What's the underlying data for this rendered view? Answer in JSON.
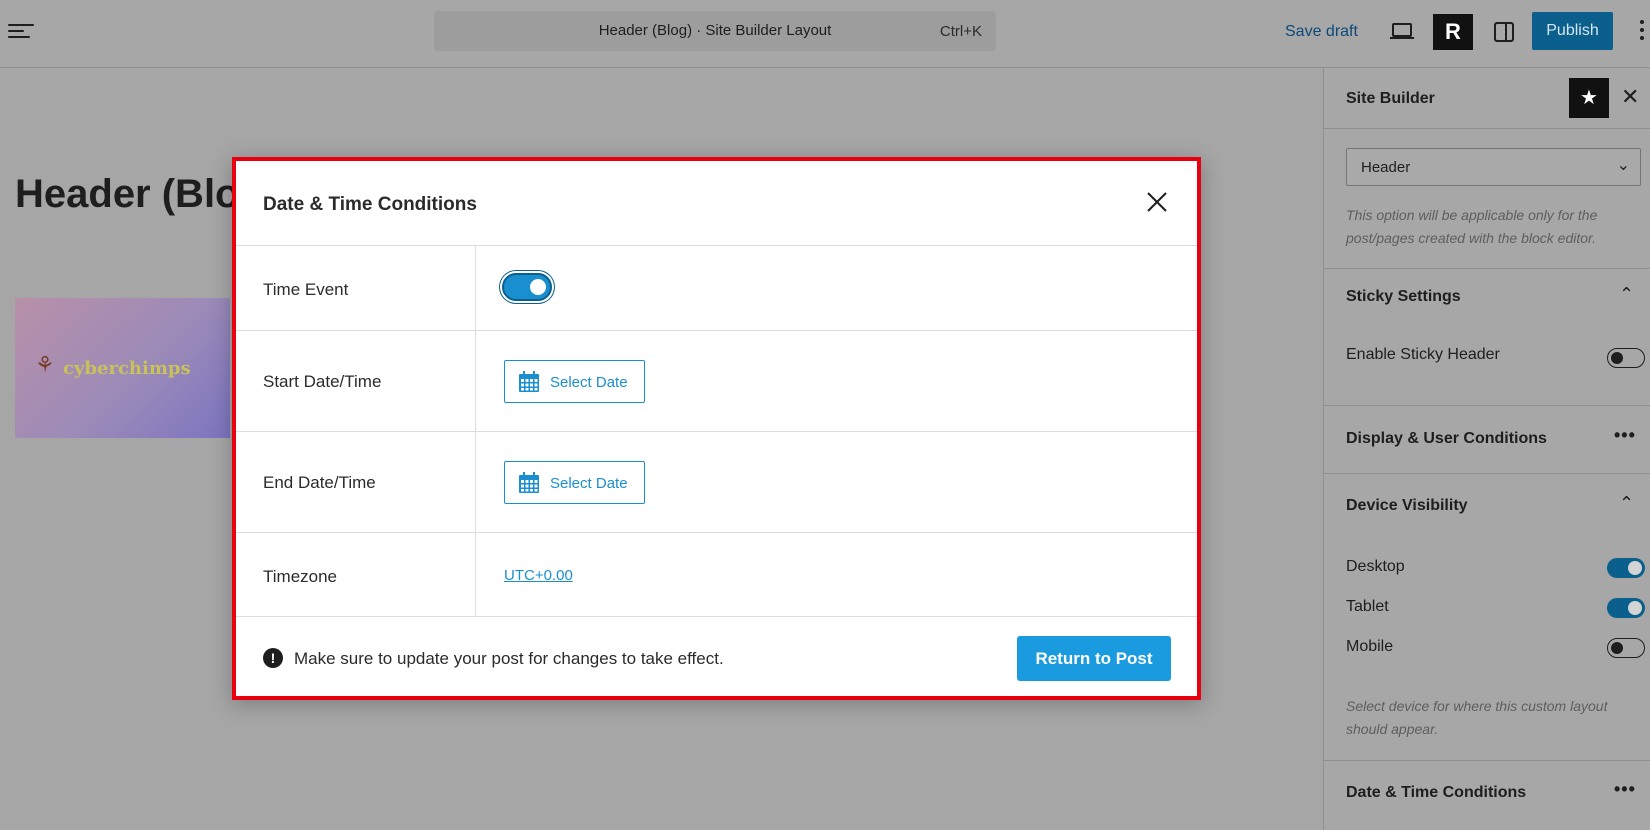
{
  "topbar": {
    "command_title": "Header (Blog) · Site Builder Layout",
    "command_shortcut": "Ctrl+K",
    "save_draft": "Save draft",
    "r_label": "R",
    "publish": "Publish"
  },
  "canvas": {
    "page_title": "Header (Blo",
    "logo_text": "cyberchimps"
  },
  "sidebar": {
    "title": "Site Builder",
    "layout_select_value": "Header",
    "layout_help": "This option will be applicable only for the post/pages created with the block editor.",
    "sticky_section": "Sticky Settings",
    "sticky_label": "Enable Sticky Header",
    "sticky_enabled": false,
    "display_section": "Display & User Conditions",
    "device_section": "Device Visibility",
    "devices": [
      {
        "label": "Desktop",
        "enabled": true
      },
      {
        "label": "Tablet",
        "enabled": true
      },
      {
        "label": "Mobile",
        "enabled": false
      }
    ],
    "device_help": "Select device for where this custom layout should appear.",
    "datetime_section": "Date & Time Conditions"
  },
  "modal": {
    "title": "Date & Time Conditions",
    "rows": {
      "time_event_label": "Time Event",
      "time_event_enabled": true,
      "start_label": "Start Date/Time",
      "start_button": "Select Date",
      "end_label": "End Date/Time",
      "end_button": "Select Date",
      "timezone_label": "Timezone",
      "timezone_value": "UTC+0.00"
    },
    "notice": "Make sure to update your post for changes to take effect.",
    "return_button": "Return to Post"
  },
  "colors": {
    "accent": "#1a9be0",
    "publish": "#0b5f8c",
    "highlight_border": "#e8000f"
  }
}
